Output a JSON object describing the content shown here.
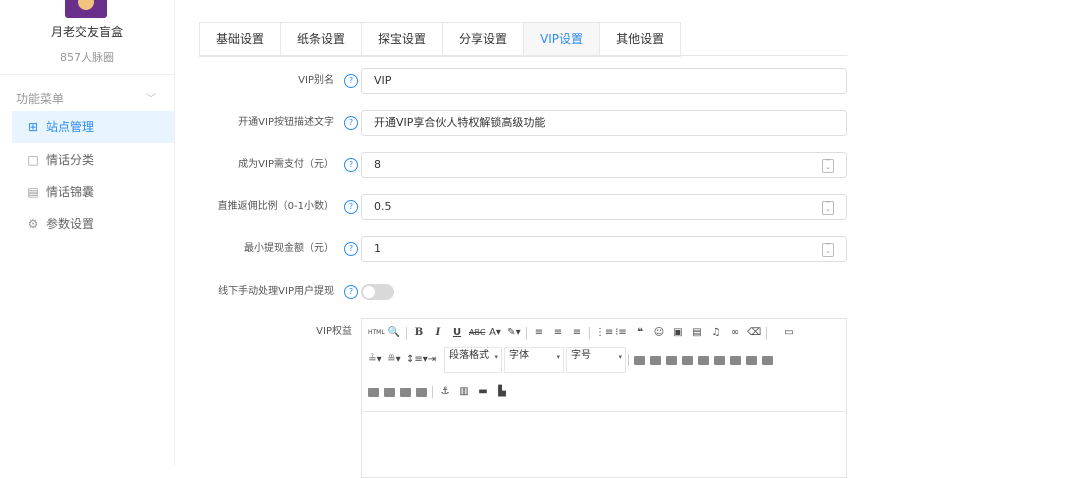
{
  "sidebar": {
    "shop_name": "月老交友盲盒",
    "shop_sub": "857人脉圈",
    "menu_title": "功能菜单",
    "items": [
      {
        "label": "站点管理",
        "icon": "gift-icon"
      },
      {
        "label": "情话分类",
        "icon": "bookmark-icon"
      },
      {
        "label": "情话锦囊",
        "icon": "note-icon"
      },
      {
        "label": "参数设置",
        "icon": "gear-icon"
      }
    ]
  },
  "tabs": [
    "基础设置",
    "纸条设置",
    "探宝设置",
    "分享设置",
    "VIP设置",
    "其他设置"
  ],
  "active_tab": "VIP设置",
  "form": {
    "vip_alias": {
      "label": "VIP别名",
      "value": "VIP"
    },
    "vip_button_desc": {
      "label": "开通VIP按钮描述文字",
      "value": "开通VIP享合伙人特权解锁高级功能"
    },
    "vip_price": {
      "label": "成为VIP需支付（元）",
      "value": "8"
    },
    "rebate_ratio": {
      "label": "直推返佣比例（0-1小数）",
      "value": "0.5"
    },
    "min_withdraw": {
      "label": "最小提现金额（元）",
      "value": "1"
    },
    "manual_withdraw": {
      "label": "线下手动处理VIP用户提现",
      "on": false
    },
    "vip_rights": {
      "label": "VIP权益"
    }
  },
  "editor": {
    "paragraph_format": "段落格式",
    "font_family": "字体",
    "font_size": "字号"
  },
  "colors": {
    "accent": "#2d8cf0",
    "active_bg": "#e8f4ff"
  }
}
